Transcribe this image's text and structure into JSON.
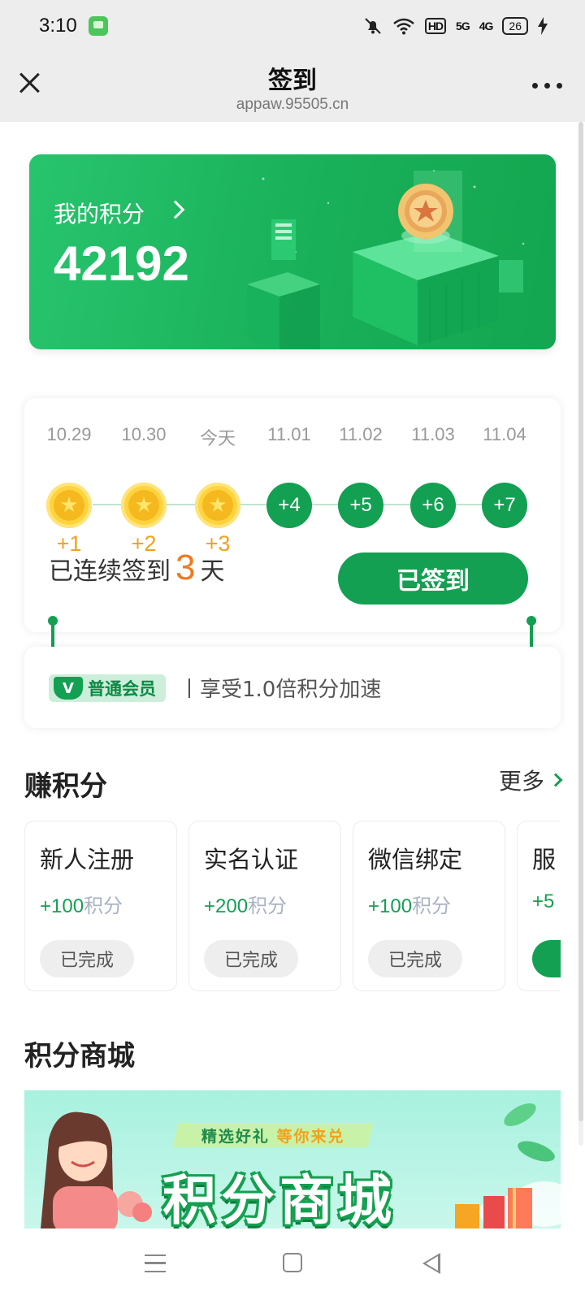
{
  "status_bar": {
    "time": "3:10",
    "hd_label": "HD",
    "net5g": "5G",
    "net4g": "4G",
    "battery": "26"
  },
  "title_bar": {
    "title": "签到",
    "url": "appaw.95505.cn"
  },
  "points": {
    "label": "我的积分",
    "value": "42192"
  },
  "checkin": {
    "days": [
      {
        "date": "10.29",
        "state": "done",
        "bonus": "+1"
      },
      {
        "date": "10.30",
        "state": "done",
        "bonus": "+2"
      },
      {
        "date": "今天",
        "state": "done",
        "bonus": "+3"
      },
      {
        "date": "11.01",
        "state": "pending",
        "bonus": "+4"
      },
      {
        "date": "11.02",
        "state": "pending",
        "bonus": "+5"
      },
      {
        "date": "11.03",
        "state": "pending",
        "bonus": "+6"
      },
      {
        "date": "11.04",
        "state": "pending",
        "bonus": "+7"
      }
    ],
    "streak_prefix": "已连续签到",
    "streak_days": "3",
    "streak_suffix": "天",
    "button_label": "已签到"
  },
  "member": {
    "badge_label": "普通会员",
    "description": "丨享受1.0倍积分加速"
  },
  "earn": {
    "title": "赚积分",
    "more_label": "更多",
    "tasks": [
      {
        "title": "新人注册",
        "points": "+100",
        "unit": "积分",
        "status": "已完成"
      },
      {
        "title": "实名认证",
        "points": "+200",
        "unit": "积分",
        "status": "已完成"
      },
      {
        "title": "微信绑定",
        "points": "+100",
        "unit": "积分",
        "status": "已完成"
      },
      {
        "title": "服",
        "points": "+5",
        "unit": "",
        "status": ""
      }
    ]
  },
  "mall": {
    "title": "积分商城",
    "banner_tag_a": "精选好礼",
    "banner_tag_b": "等你来兑",
    "banner_title": "积分商城"
  },
  "colors": {
    "brand_green": "#13a052",
    "accent_orange": "#f07a1f",
    "coin_gold": "#ffd33d"
  }
}
